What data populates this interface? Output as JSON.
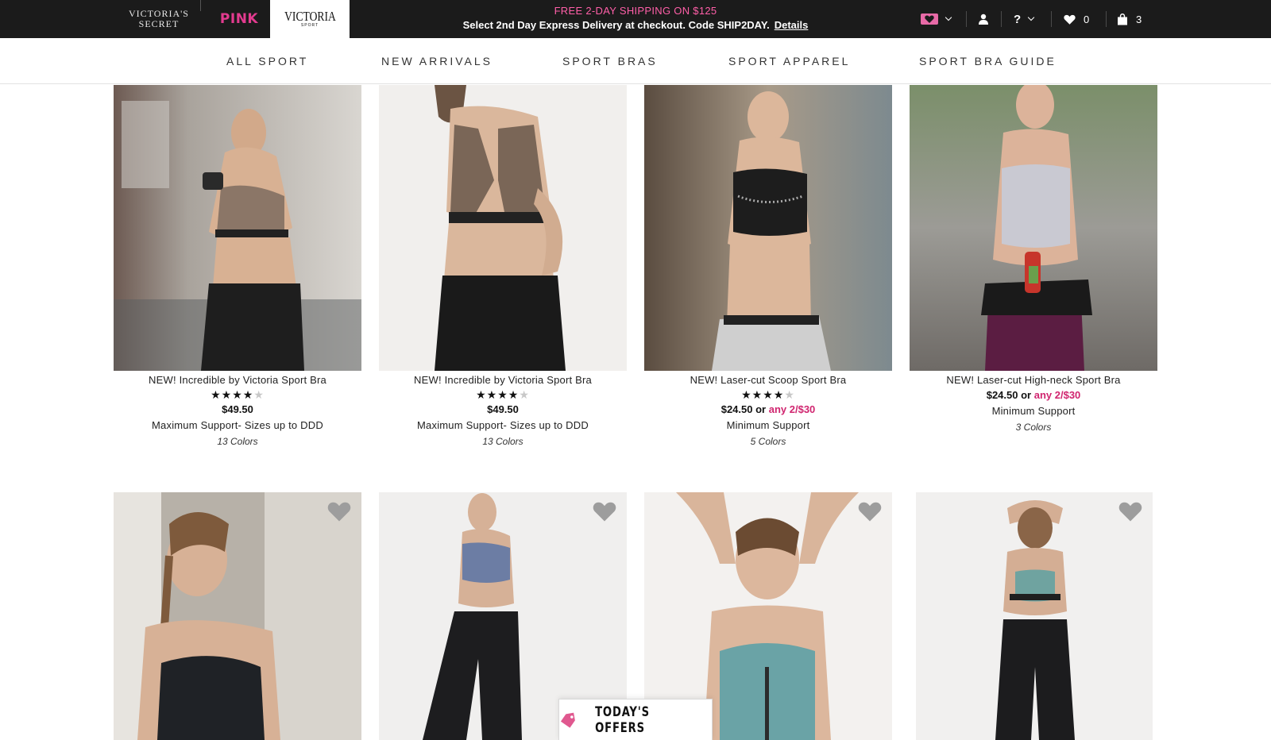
{
  "brands": {
    "vs_line1": "VICTORIA'S",
    "vs_line2": "SECRET",
    "pink": "PINK",
    "sport_big": "VICTORIA",
    "sport_small": "SPORT"
  },
  "promo": {
    "line1": "FREE 2-DAY SHIPPING ON $125",
    "line2": "Select 2nd Day Express Delivery at checkout. Code SHIP2DAY.",
    "details": "Details"
  },
  "utility": {
    "favorites_count": "0",
    "bag_count": "3",
    "help": "?"
  },
  "nav": [
    "ALL SPORT",
    "NEW ARRIVALS",
    "SPORT BRAS",
    "SPORT APPAREL",
    "SPORT BRA GUIDE"
  ],
  "products": [
    {
      "name": "NEW! Incredible by Victoria Sport Bra",
      "stars": "★★★★",
      "stars_off": "★",
      "price": "$49.50",
      "or": "",
      "offer": "",
      "support": "Maximum Support- Sizes up to DDD",
      "colors": "13 Colors",
      "rating": 4
    },
    {
      "name": "NEW! Incredible by Victoria Sport Bra",
      "stars": "★★★★",
      "stars_off": "★",
      "price": "$49.50",
      "or": "",
      "offer": "",
      "support": "Maximum Support- Sizes up to DDD",
      "colors": "13 Colors",
      "rating": 4
    },
    {
      "name": "NEW! Laser-cut Scoop Sport Bra",
      "stars": "★★★★",
      "stars_off": "★",
      "price": "$24.50",
      "or": "or",
      "offer": "any 2/$30",
      "support": "Minimum Support",
      "colors": "5 Colors",
      "rating": 4
    },
    {
      "name": "NEW! Laser-cut High-neck Sport Bra",
      "stars": "",
      "stars_off": "",
      "price": "$24.50",
      "or": "or",
      "offer": "any 2/$30",
      "support": "Minimum Support",
      "colors": "3 Colors"
    }
  ],
  "offers": {
    "label": "TODAY'S OFFERS"
  },
  "colors": {
    "topbar": "#1b1b1b",
    "pink": "#e23b8f",
    "promo_pink": "#ff5fa8",
    "offer_red": "#d0256f"
  }
}
